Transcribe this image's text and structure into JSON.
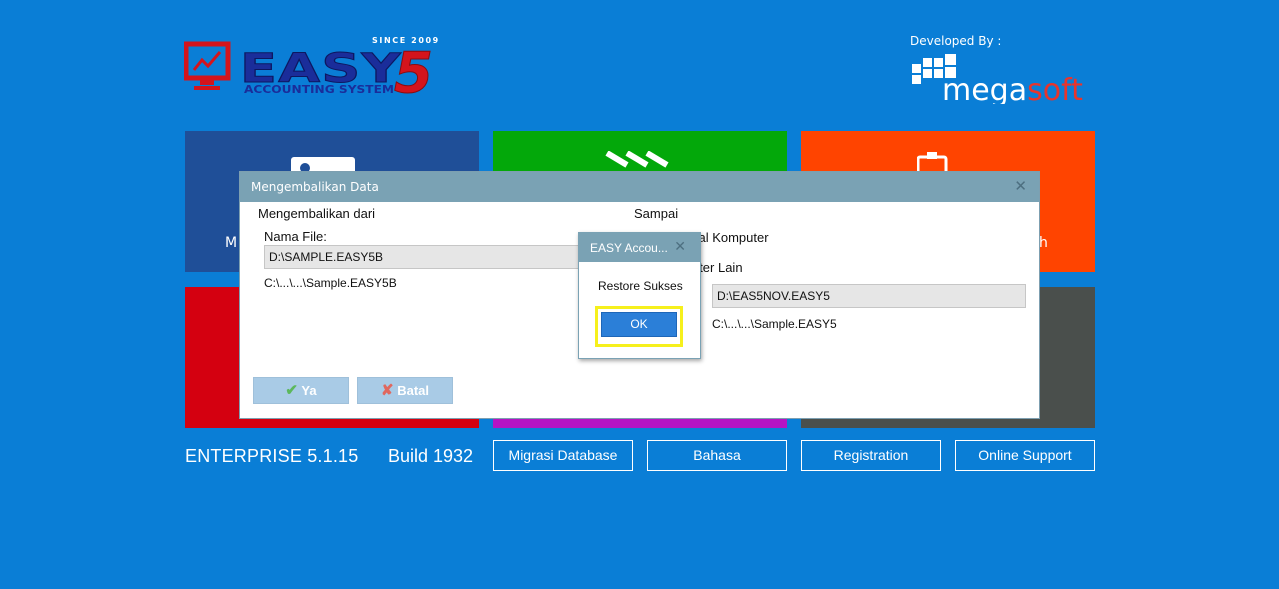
{
  "logo": {
    "since": "SINCE 2009",
    "brand": "EASY",
    "version_number": "5",
    "subtitle": "ACCOUNTING SYSTEM"
  },
  "developer": {
    "label": "Developed By :",
    "brand_part1": "mega",
    "brand_part2": "soft"
  },
  "tiles": {
    "tile_1_partial": "M",
    "tile_3_partial": "h"
  },
  "footer": {
    "edition": "ENTERPRISE 5.1.15",
    "build": "Build 1932",
    "buttons": [
      "Migrasi Database",
      "Bahasa",
      "Registration",
      "Online Support"
    ]
  },
  "restore_dialog": {
    "title": "Mengembalikan Data",
    "from_label": "Mengembalikan dari",
    "file_label": "Nama File:",
    "file_value": "D:\\SAMPLE.EASY5B",
    "file_path": "C:\\...\\...\\Sample.EASY5B",
    "to_label": "Sampai",
    "option_local": "Ke Lokal Komputer",
    "option_other": "Komputer Lain",
    "target_value": "D:\\EAS5NOV.EASY5",
    "target_path": "C:\\...\\...\\Sample.EASY5",
    "yes_label": "Ya",
    "cancel_label": "Batal"
  },
  "message_box": {
    "title": "EASY Accou...",
    "message": "Restore Sukses",
    "ok_label": "OK"
  },
  "colors": {
    "background": "#0a7ed6",
    "tile_blue": "#1f4f98",
    "tile_green": "#03a80a",
    "tile_orange": "#ff4400",
    "tile_red": "#d40010",
    "tile_purple": "#b414c4",
    "tile_gray": "#4a4f4c",
    "dialog_titlebar": "#7aa2b4",
    "highlight": "#f6f01c"
  }
}
